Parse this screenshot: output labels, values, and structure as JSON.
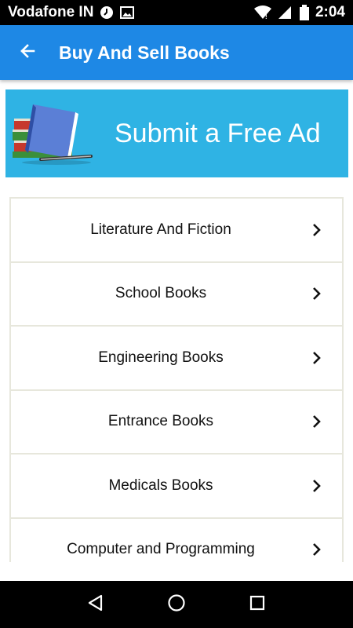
{
  "status_bar": {
    "carrier": "Vodafone IN",
    "time": "2:04",
    "icons": [
      "clock-badge-icon",
      "image-icon",
      "wifi-icon",
      "signal-icon",
      "battery-icon"
    ]
  },
  "app_bar": {
    "title": "Buy And Sell Books",
    "back_icon": "back-arrow-icon",
    "color": "#1e88e5"
  },
  "banner": {
    "text": "Submit a Free Ad",
    "color": "#2fb3e4",
    "image": "books-stack-icon"
  },
  "categories": [
    {
      "label": "Literature And Fiction"
    },
    {
      "label": "School Books"
    },
    {
      "label": "Engineering Books"
    },
    {
      "label": "Entrance Books"
    },
    {
      "label": "Medicals Books"
    },
    {
      "label": "Computer and Programming"
    }
  ],
  "nav_bar": {
    "icons": [
      "back-triangle-icon",
      "home-circle-icon",
      "recents-square-icon"
    ]
  }
}
